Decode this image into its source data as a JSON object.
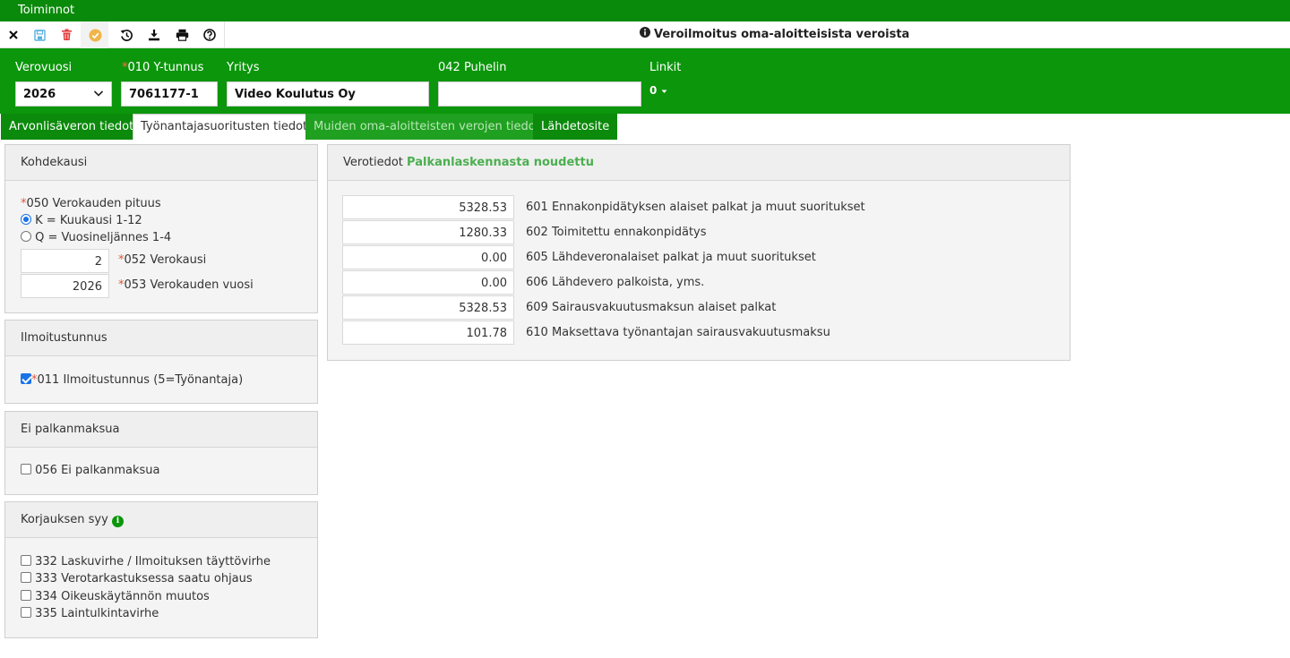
{
  "menu": {
    "label": "Toiminnot"
  },
  "toolbar": {
    "icons": [
      "close-icon",
      "save-icon",
      "delete-icon",
      "approve-icon",
      "history-icon",
      "download-icon",
      "print-icon",
      "help-icon"
    ],
    "title": "Veroilmoitus oma-aloitteisista veroista"
  },
  "header": {
    "verovuosi_label": "Verovuosi",
    "verovuosi_value": "2026",
    "ytunnus_label": "010 Y-tunnus",
    "ytunnus_value": "7061177-1",
    "yritys_label": "Yritys",
    "yritys_value": "Video Koulutus Oy",
    "puhelin_label": "042 Puhelin",
    "puhelin_value": "",
    "linkit_label": "Linkit",
    "linkit_value": "0"
  },
  "tabs": [
    {
      "label": "Arvonlisäveron tiedot"
    },
    {
      "label": "Työnantajasuoritusten tiedot"
    },
    {
      "label": "Muiden oma-aloitteisten verojen tiedot"
    },
    {
      "label": "Lähdetosite"
    }
  ],
  "kohdekausi": {
    "title": "Kohdekausi",
    "pituus_label": "050 Verokauden pituus",
    "opt_k": "K = Kuukausi 1-12",
    "opt_q": "Q = Vuosineljännes 1-4",
    "selected": "K",
    "verokausi_value": "2",
    "verokausi_label": "052 Verokausi",
    "vuosi_value": "2026",
    "vuosi_label": "053 Verokauden vuosi"
  },
  "ilmoitustunnus": {
    "title": "Ilmoitustunnus",
    "checkbox_label": "011 Ilmoitustunnus (5=Työnantaja)",
    "checked": true
  },
  "ei_palkanmaksua": {
    "title": "Ei palkanmaksua",
    "checkbox_label": "056 Ei palkanmaksua",
    "checked": false
  },
  "korjaus": {
    "title": "Korjauksen syy",
    "options": [
      {
        "label": "332 Laskuvirhe / Ilmoituksen täyttövirhe",
        "checked": false
      },
      {
        "label": "333 Verotarkastuksessa saatu ohjaus",
        "checked": false
      },
      {
        "label": "334 Oikeuskäytännön muutos",
        "checked": false
      },
      {
        "label": "335 Laintulkintavirhe",
        "checked": false
      }
    ]
  },
  "verotiedot": {
    "title": "Verotiedot",
    "status": "Palkanlaskennasta noudettu",
    "rows": [
      {
        "value": "5328.53",
        "label": "601 Ennakonpidätyksen alaiset palkat ja muut suoritukset"
      },
      {
        "value": "1280.33",
        "label": "602 Toimitettu ennakonpidätys"
      },
      {
        "value": "0.00",
        "label": "605 Lähdeveronalaiset palkat ja muut suoritukset"
      },
      {
        "value": "0.00",
        "label": "606 Lähdevero palkoista, yms."
      },
      {
        "value": "5328.53",
        "label": "609 Sairausvakuutusmaksun alaiset palkat"
      },
      {
        "value": "101.78",
        "label": "610 Maksettava työnantajan sairausvakuutusmaksu"
      }
    ]
  },
  "colors": {
    "brand_green": "#0b960b",
    "required": "#e0573a",
    "status_green": "#4caf50"
  }
}
